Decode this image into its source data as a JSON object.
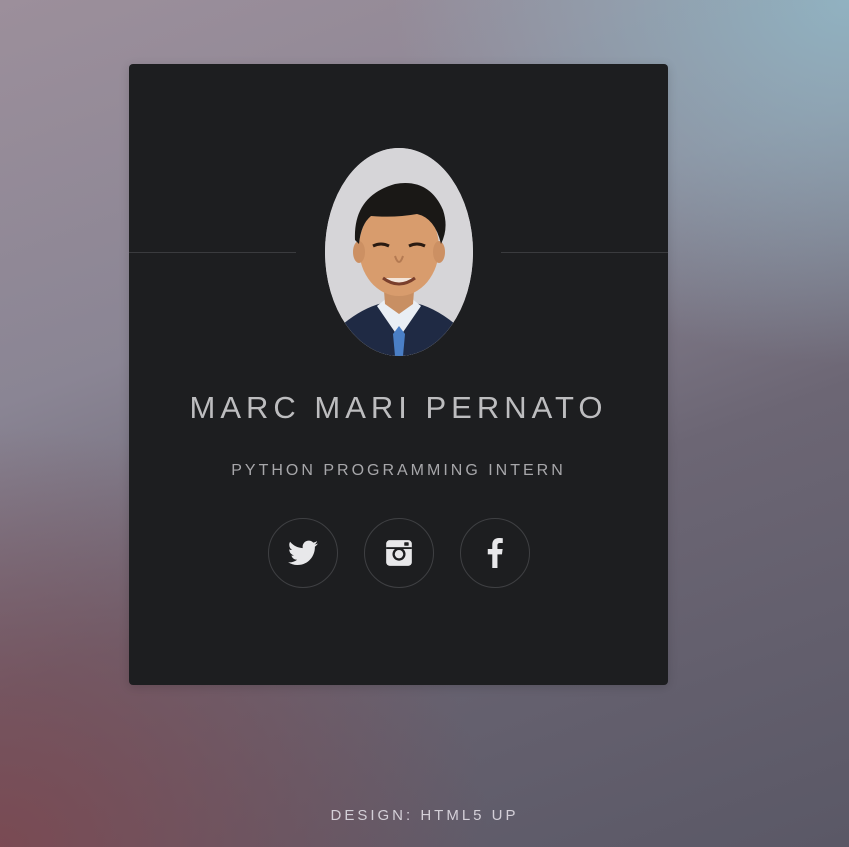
{
  "profile": {
    "name": "MARC MARI PERNATO",
    "role": "PYTHON PROGRAMMING INTERN",
    "photo_alt": "avatar"
  },
  "social": {
    "items": [
      {
        "icon": "twitter-icon",
        "label": "Twitter"
      },
      {
        "icon": "instagram-icon",
        "label": "Instagram"
      },
      {
        "icon": "facebook-icon",
        "label": "Facebook"
      }
    ]
  },
  "footer": {
    "credit": "DESIGN: HTML5 UP"
  },
  "colors": {
    "card_bg": "#1d1e20",
    "text_primary": "#bdbdbf",
    "text_secondary": "#a7a7aa",
    "icon_color": "#e8e8ea"
  }
}
